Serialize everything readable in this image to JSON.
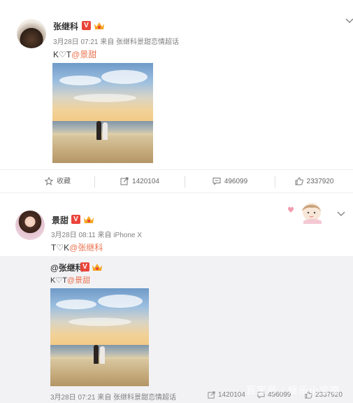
{
  "post1": {
    "author": "张继科",
    "meta": "3月28日 07:21 来自 张继科景甜恋情超话",
    "text_prefix": "K♡T",
    "mention": "@景甜",
    "actions": {
      "favorite": "收藏",
      "repost": "1420104",
      "comment": "496099",
      "like": "2337920"
    }
  },
  "post2": {
    "author": "景甜",
    "meta": "3月28日 08:11 来自 iPhone X",
    "text_prefix": "T♡K",
    "mention": "@张继科",
    "repost": {
      "author": "@张继科",
      "text_prefix": "K♡T",
      "mention": "@景甜",
      "meta": "3月28日 07:21 来自 张继科景甜恋情超话",
      "repost_count": "1420104",
      "comment_count": "496099",
      "like_count": "2337920"
    }
  },
  "badge_v": "V",
  "watermark": "百家号 / 娱乐小宝喵",
  "colors": {
    "accent": "#eb7350",
    "verified": "#e9443a",
    "repost_bg": "#f2f2f5"
  },
  "icons": [
    "chevron-down-icon",
    "star-icon",
    "repost-icon",
    "comment-icon",
    "like-icon",
    "crown-icon"
  ]
}
